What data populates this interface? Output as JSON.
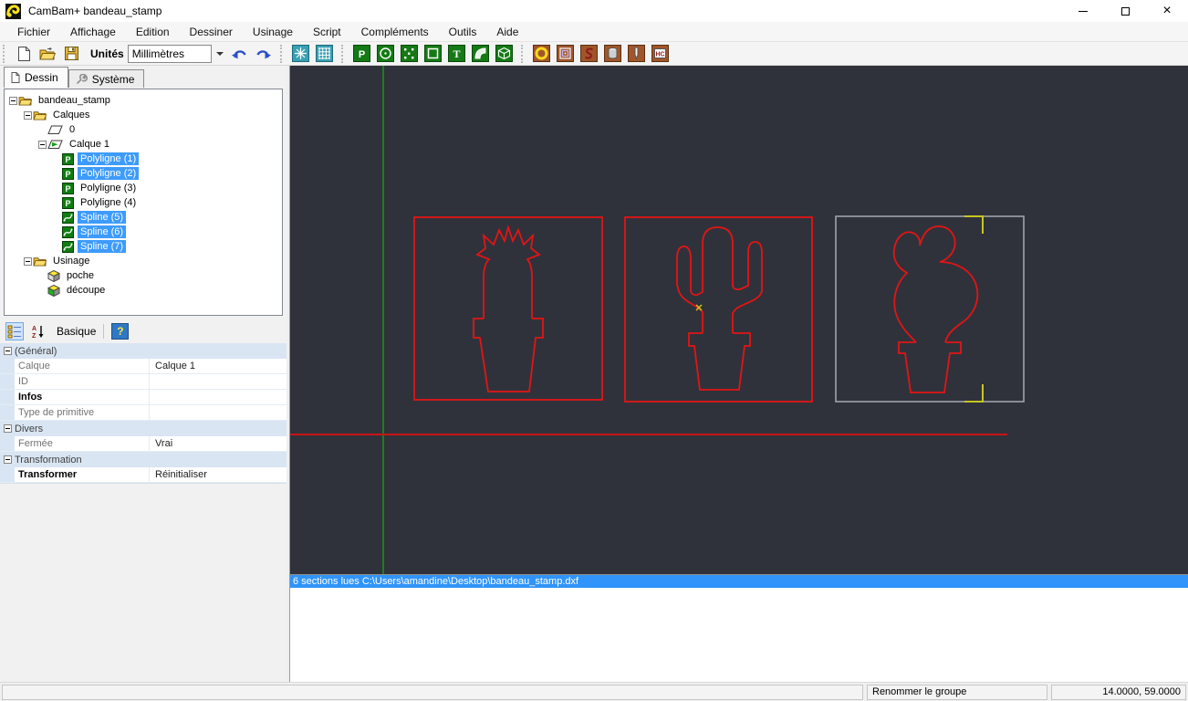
{
  "window": {
    "title": "CamBam+  bandeau_stamp",
    "controls": {
      "minimize": "minimize",
      "restore": "restore",
      "close": "close"
    }
  },
  "menu": {
    "items": [
      "Fichier",
      "Affichage",
      "Edition",
      "Dessiner",
      "Usinage",
      "Script",
      "Compléments",
      "Outils",
      "Aide"
    ]
  },
  "toolbar": {
    "file_icons": [
      "new-file-icon",
      "open-file-icon",
      "save-icon"
    ],
    "unites_label": "Unités",
    "units_value": "Millimètres",
    "history_icons": [
      "undo-icon",
      "redo-icon"
    ],
    "view_icons": [
      "snap-icon",
      "grid-icon"
    ],
    "draw_icons": [
      "draw-polyline-icon",
      "draw-circle-icon",
      "draw-points-icon",
      "draw-rectangle-icon",
      "draw-text-icon",
      "draw-arc-icon",
      "draw-surface-icon"
    ],
    "machining_icons": [
      "mop-pocket-icon",
      "mop-profile-icon",
      "mop-engrave-icon",
      "mop-drill-icon",
      "mop-lathe-icon",
      "mop-heightcut-icon"
    ]
  },
  "tabs": [
    {
      "id": "dessin",
      "label": "Dessin",
      "icon": "page-icon",
      "active": true
    },
    {
      "id": "systeme",
      "label": "Système",
      "icon": "wrench-icon",
      "active": false
    }
  ],
  "tree": {
    "items": [
      {
        "depth": 0,
        "expander": true,
        "icon": "folder-icon",
        "label": "bandeau_stamp",
        "selected": false
      },
      {
        "depth": 1,
        "expander": true,
        "icon": "folder-icon",
        "label": "Calques",
        "selected": false
      },
      {
        "depth": 2,
        "expander": false,
        "icon": "layer-icon",
        "label": "0",
        "selected": false
      },
      {
        "depth": 2,
        "expander": true,
        "icon": "layer-active-icon",
        "label": "Calque 1",
        "selected": false
      },
      {
        "depth": 3,
        "expander": false,
        "icon": "polyline-obj-icon",
        "label": "Polyligne (1)",
        "selected": true
      },
      {
        "depth": 3,
        "expander": false,
        "icon": "polyline-obj-icon",
        "label": "Polyligne (2)",
        "selected": true
      },
      {
        "depth": 3,
        "expander": false,
        "icon": "polyline-obj-icon",
        "label": "Polyligne (3)",
        "selected": false
      },
      {
        "depth": 3,
        "expander": false,
        "icon": "polyline-obj-icon",
        "label": "Polyligne (4)",
        "selected": false
      },
      {
        "depth": 3,
        "expander": false,
        "icon": "spline-obj-icon",
        "label": "Spline (5)",
        "selected": true
      },
      {
        "depth": 3,
        "expander": false,
        "icon": "spline-obj-icon",
        "label": "Spline (6)",
        "selected": true
      },
      {
        "depth": 3,
        "expander": false,
        "icon": "spline-obj-icon",
        "label": "Spline (7)",
        "selected": true
      },
      {
        "depth": 1,
        "expander": true,
        "icon": "folder-icon",
        "label": "Usinage",
        "selected": false
      },
      {
        "depth": 2,
        "expander": false,
        "icon": "cube-pocket-icon",
        "label": "poche",
        "selected": false
      },
      {
        "depth": 2,
        "expander": false,
        "icon": "cube-profile-icon",
        "label": "découpe",
        "selected": false
      }
    ]
  },
  "properties": {
    "toolbar": {
      "view_label": "Basique",
      "help_label": "?",
      "icons": [
        "categorized-icon",
        "sort-az-icon"
      ]
    },
    "rows": [
      {
        "type": "category",
        "label": "(Général)"
      },
      {
        "type": "row",
        "name": "Calque",
        "value": "Calque 1",
        "bold": false
      },
      {
        "type": "row",
        "name": "ID",
        "value": "",
        "bold": false
      },
      {
        "type": "row",
        "name": "Infos",
        "value": "",
        "bold": true
      },
      {
        "type": "row",
        "name": "Type de primitive",
        "value": "",
        "bold": false
      },
      {
        "type": "category",
        "label": "Divers"
      },
      {
        "type": "row",
        "name": "Fermée",
        "value": "Vrai",
        "bold": false
      },
      {
        "type": "category",
        "label": "Transformation"
      },
      {
        "type": "row",
        "name": "Transformer",
        "value": "Réinitialiser",
        "bold": true
      }
    ]
  },
  "canvas": {
    "log_line": "6 sections lues C:\\Users\\amandine\\Desktop\\bandeau_stamp.dxf",
    "colors": {
      "background": "#2f323b",
      "shape_red": "#e41414",
      "axis_red": "#c81414",
      "axis_green": "#1f7d1f",
      "selection_gray": "#a0a3a8",
      "highlight_yellow": "#c8c61f"
    }
  },
  "statusbar": {
    "group_label": "Renommer le groupe",
    "coordinates": "14.0000, 59.0000"
  }
}
